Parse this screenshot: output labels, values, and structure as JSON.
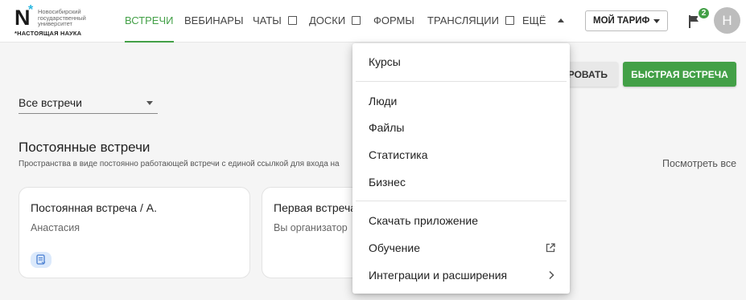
{
  "logo": {
    "mark": "N",
    "university": "Новосибирский государственный университет",
    "tagline": "*НАСТОЯЩАЯ НАУКА"
  },
  "nav": {
    "items": [
      {
        "label": "ВСТРЕЧИ",
        "active": true,
        "external": false
      },
      {
        "label": "ВЕБИНАРЫ",
        "active": false,
        "external": false
      },
      {
        "label": "ЧАТЫ",
        "active": false,
        "external": true
      },
      {
        "label": "ДОСКИ",
        "active": false,
        "external": true
      },
      {
        "label": "ФОРМЫ",
        "active": false,
        "external": false
      },
      {
        "label": "ТРАНСЛЯЦИИ",
        "active": false,
        "external": true
      },
      {
        "label": "ЕЩЁ",
        "active": false,
        "external": false
      }
    ],
    "tariff_label": "МОЙ ТАРИФ",
    "notifications_count": "2",
    "avatar_letter": "Н"
  },
  "actions": {
    "plan_label": "РОВАТЬ",
    "quick_label": "БЫСТРАЯ ВСТРЕЧА"
  },
  "filter": {
    "selected": "Все встречи"
  },
  "section": {
    "title": "Постоянные встречи",
    "subtitle": "Пространства в виде постоянно работающей встречи с единой ссылкой для входа на",
    "see_all": "Посмотреть все"
  },
  "cards": [
    {
      "title": "Постоянная встреча / А.",
      "owner": "Анастасия",
      "has_icon": true
    },
    {
      "title": "Первая встреча",
      "owner": "Вы организатор",
      "has_icon": false
    }
  ],
  "menu": {
    "group1": [
      "Курсы"
    ],
    "group2": [
      "Люди",
      "Файлы",
      "Статистика",
      "Бизнес"
    ],
    "group3": [
      {
        "label": "Скачать приложение",
        "suffix": "none"
      },
      {
        "label": "Обучение",
        "suffix": "external-link-icon"
      },
      {
        "label": "Интеграции и расширения",
        "suffix": "chevron-right-icon"
      }
    ]
  },
  "colors": {
    "accent": "#43a047",
    "badge": "#43a047",
    "avatar_bg": "#bdbdbd",
    "logo_star": "#2bb7e0"
  }
}
